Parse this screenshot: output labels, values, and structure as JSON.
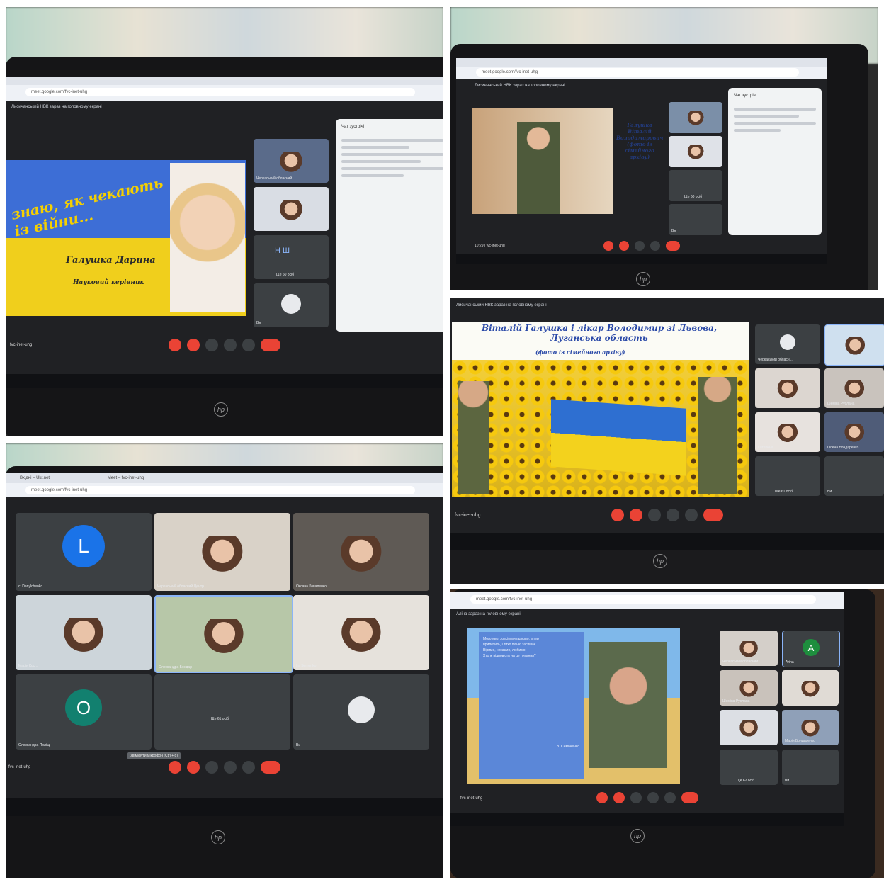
{
  "panel1": {
    "address": "meet.google.com/fvc-inet-uhg",
    "meet_banner": "Лисичанський НВК зараз на головному екрані",
    "slide_title": "знаю, як чекають із війни...",
    "slide_author": "Галушка Дарина",
    "slide_sub": "Науковий керівник",
    "chat_title": "Чат зустрічі",
    "tile_label": "Черкаський обласний...",
    "others": "Ще 60 осіб",
    "self": "Ви",
    "initials": "Н   Ш",
    "meeting_code": "fvc-inet-uhg",
    "laptop_brand": "hp"
  },
  "panel2": {
    "address": "meet.google.com/fvc-inet-uhg",
    "meet_banner": "Лисичанський НВК зараз на головному екрані",
    "slide_caption": "Галушка Віталій Володимирович (фото із сімейного архіву)",
    "chat_title": "Чат зустрічі",
    "others": "Ще 60 осіб",
    "self": "Ви",
    "time": "10:29",
    "meeting_code": "fvc-inet-uhg",
    "laptop_brand": "hp"
  },
  "panel3": {
    "meet_banner": "Лисичанський НВК зараз на головному екрані",
    "slide_title": "Віталій Галушка і лікар Володимир зі Львова, Луганська область",
    "slide_sub": "(фото із сімейного архіву)",
    "tile_labels": [
      "Черкаський обласн...",
      "Шеміна Руслана",
      "Катерина",
      "Олена Бондаренко"
    ],
    "others": "Ще 61 осіб",
    "self": "Ви",
    "meeting_code": "fvc-inet-uhg",
    "laptop_brand": "hp"
  },
  "panel4": {
    "address": "meet.google.com/fvc-inet-uhg",
    "tabs": [
      "Вхідні – Ukr.net",
      "Meet – fvc-inet-uhg"
    ],
    "tiles": [
      {
        "name": "c. Danylchenko",
        "initial": "L"
      },
      {
        "name": "Черкаський обласний Центр..."
      },
      {
        "name": "Оксана Коваленко"
      },
      {
        "name": "Марія Кос..."
      },
      {
        "name": "Олександра Бондар"
      },
      {
        "name": "Ira Semenko"
      },
      {
        "name": "Олександра Поліщ",
        "initial": "O"
      },
      {
        "name": "Ще 61 осіб"
      },
      {
        "name": "Ви"
      }
    ],
    "tooltip": "Увімкнути мікрофон (Ctrl + d)",
    "meeting_code": "fvc-inet-uhg",
    "laptop_brand": "hp"
  },
  "panel5": {
    "address": "meet.google.com/fvc-inet-uhg",
    "meet_banner": "Аліна зараз на головному екрані",
    "poem_lines": [
      "Можливо, зовсім випадково, вітер",
      "прилетить, і тихо пісню заспіває...",
      "Віримо, чекаємо, любимо",
      "Хто ж відповість на це питання?"
    ],
    "poem_author": "В. Симоненко",
    "tile_labels": [
      "Черкаський обласний...",
      "Arina",
      "Шеміна Руслана",
      "Марія Бондаренко"
    ],
    "initial": "A",
    "others": "Ще 62 осіб",
    "self": "Ви",
    "meeting_code": "fvc-inet-uhg",
    "laptop_brand": "hp"
  },
  "colors": {
    "meet_bg": "#202124",
    "tile": "#3c4043",
    "end_call": "#ea4335",
    "ua_blue": "#2e6fd1",
    "ua_yellow": "#f3d21d"
  }
}
